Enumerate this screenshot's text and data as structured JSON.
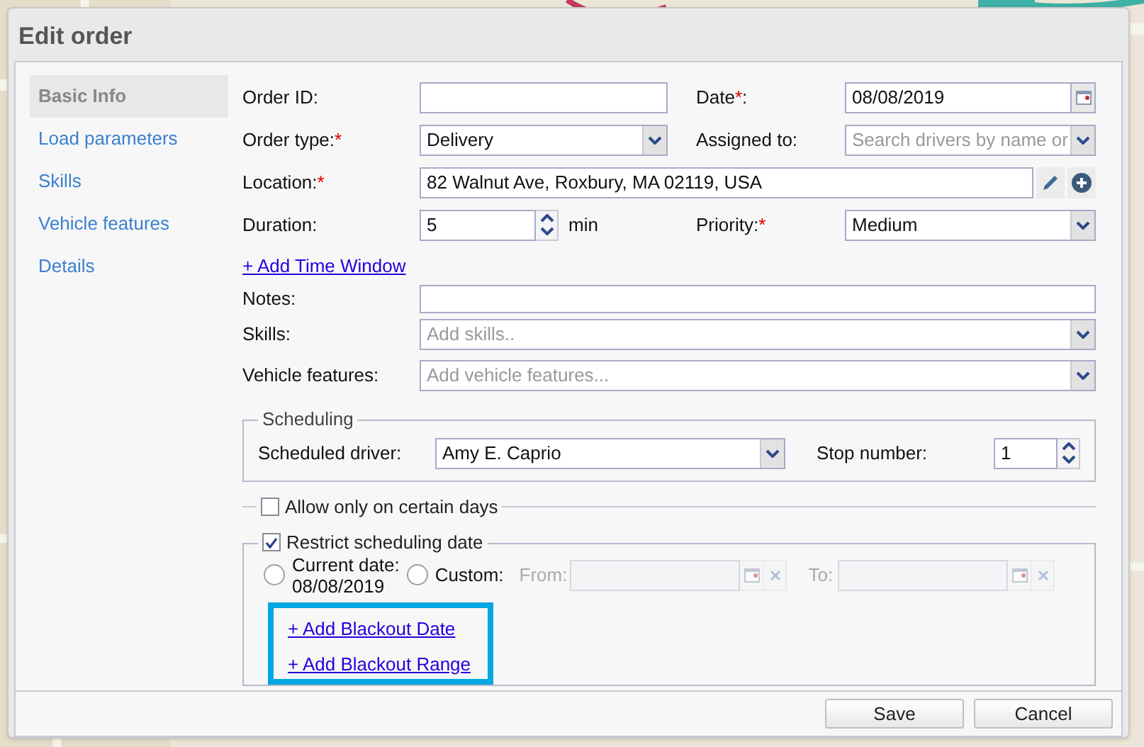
{
  "dialog": {
    "title": "Edit order"
  },
  "sidebar": {
    "items": [
      {
        "label": "Basic Info",
        "selected": true
      },
      {
        "label": "Load parameters",
        "selected": false
      },
      {
        "label": "Skills",
        "selected": false
      },
      {
        "label": "Vehicle features",
        "selected": false
      },
      {
        "label": "Details",
        "selected": false
      }
    ]
  },
  "form": {
    "order_id": {
      "label": "Order ID:"
    },
    "date": {
      "label": "Date",
      "required_mark": "*",
      "label_end": ":",
      "value": "08/08/2019"
    },
    "order_type": {
      "label": "Order type:",
      "required_mark": "*",
      "value": "Delivery"
    },
    "assigned_to": {
      "label": "Assigned to:",
      "placeholder": "Search drivers by name or"
    },
    "location": {
      "label": "Location:",
      "required_mark": "*",
      "value": "82 Walnut Ave, Roxbury, MA 02119, USA"
    },
    "duration": {
      "label": "Duration:",
      "value": "5",
      "unit": "min"
    },
    "priority": {
      "label": "Priority:",
      "required_mark": "*",
      "value": "Medium"
    },
    "add_time_window": "+ Add Time Window",
    "notes": {
      "label": "Notes:"
    },
    "skills": {
      "label": "Skills:",
      "placeholder": "Add skills.."
    },
    "vehicle_features": {
      "label": "Vehicle features:",
      "placeholder": "Add vehicle features..."
    }
  },
  "scheduling": {
    "legend": "Scheduling",
    "driver_label": "Scheduled driver:",
    "driver": "Amy E. Caprio",
    "stop_label": "Stop number:",
    "stop": "1"
  },
  "allow_certain_days": {
    "label": "Allow only on certain days",
    "checked": false
  },
  "restrict_date": {
    "label": "Restrict scheduling date",
    "checked": true,
    "current_date": {
      "label": "Current date:",
      "date": "08/08/2019",
      "selected": false
    },
    "custom": {
      "label": "Custom:",
      "selected": false
    },
    "from": {
      "label": "From:",
      "disabled": true
    },
    "to": {
      "label": "To:",
      "disabled": true
    },
    "links": [
      "+ Add Blackout Date",
      "+ Add Blackout Range"
    ]
  },
  "buttons": [
    "Save",
    "Cancel"
  ]
}
